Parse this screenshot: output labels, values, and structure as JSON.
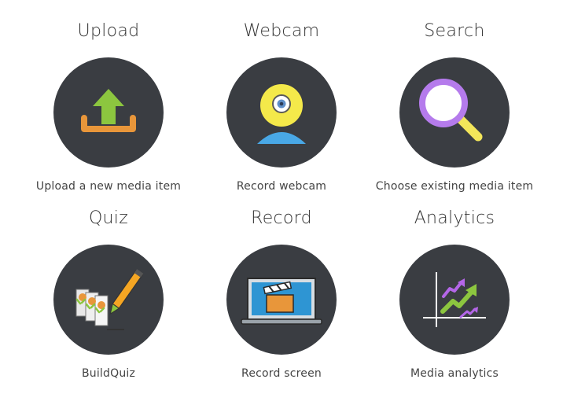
{
  "tiles": [
    {
      "title": "Upload",
      "caption": "Upload a new media item",
      "icon": "upload-icon"
    },
    {
      "title": "Webcam",
      "caption": "Record webcam",
      "icon": "webcam-icon"
    },
    {
      "title": "Search",
      "caption": "Choose existing media item",
      "icon": "search-icon"
    },
    {
      "title": "Quiz",
      "caption": "BuildQuiz",
      "icon": "quiz-icon"
    },
    {
      "title": "Record",
      "caption": "Record screen",
      "icon": "screen-record-icon"
    },
    {
      "title": "Analytics",
      "caption": "Media analytics",
      "icon": "analytics-chart-icon"
    }
  ],
  "colors": {
    "circle_bg": "#3a3d42",
    "upload_arrow": "#8cc63f",
    "upload_tray": "#e8963a",
    "webcam_body": "#f4e94a",
    "webcam_base": "#49a8e6",
    "search_ring": "#b57bec",
    "search_handle": "#f3e65a",
    "analytics_green": "#8cc63f",
    "analytics_purple": "#b466e8"
  }
}
